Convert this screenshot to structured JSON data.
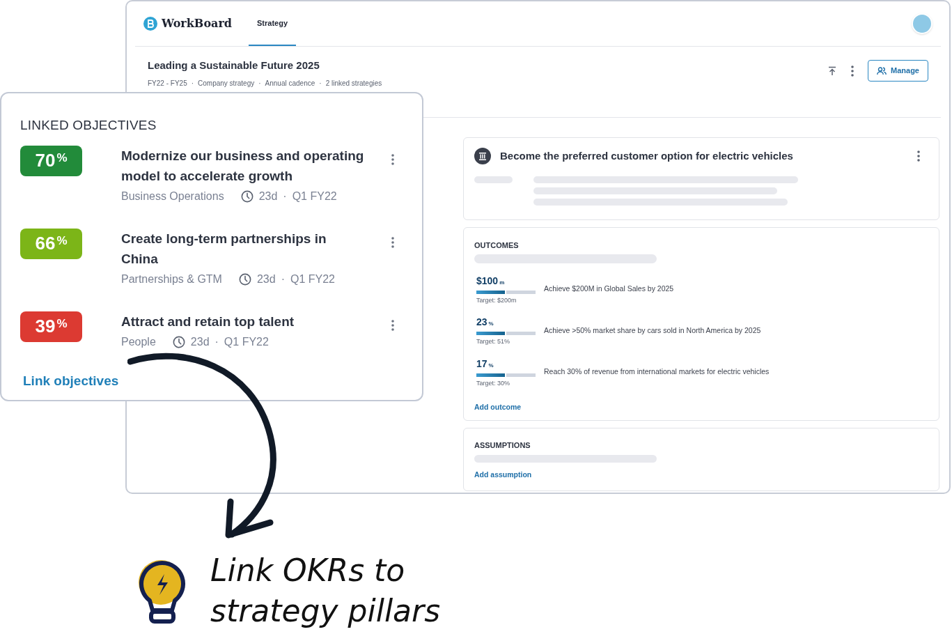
{
  "app": {
    "name": "WorkBoard",
    "tabs": [
      {
        "label": "Strategy",
        "selected": true
      }
    ]
  },
  "strategy": {
    "title": "Leading a Sustainable Future 2025",
    "separator": "·",
    "meta": [
      "FY22 - FY25",
      "Company strategy",
      "Annual cadence",
      "2 linked strategies"
    ],
    "manage_button": "Manage"
  },
  "pillar": {
    "title": "Become the preferred customer option for electric vehicles"
  },
  "outcomes": {
    "heading": "OUTCOMES",
    "items": [
      {
        "value": "$100",
        "unit": "m",
        "level": 0.5,
        "target": "Target: $200m",
        "text": "Achieve $200M in Global Sales by 2025"
      },
      {
        "value": "23",
        "unit": "%",
        "level": 0.5,
        "target": "Target: 51%",
        "text": "Achieve >50% market share by cars sold in North America by 2025"
      },
      {
        "value": "17",
        "unit": "%",
        "level": 0.5,
        "target": "Target: 30%",
        "text": "Reach 30% of revenue from international markets for electric vehicles"
      }
    ],
    "add_link": "Add outcome"
  },
  "assumptions": {
    "heading": "ASSUMPTIONS",
    "add_link": "Add assumption"
  },
  "linked_objectives": {
    "heading": "LINKED OBJECTIVES",
    "separator": "·",
    "items": [
      {
        "percent": "70",
        "unit": "%",
        "color": "#228b3a",
        "title": "Modernize our business and operating model to accelerate growth",
        "team": "Business Operations",
        "age": "23d",
        "period": "Q1 FY22"
      },
      {
        "percent": "66",
        "unit": "%",
        "color": "#7cb518",
        "title": "Create long-term partnerships in China",
        "team": "Partnerships & GTM",
        "age": "23d",
        "period": "Q1 FY22"
      },
      {
        "percent": "39",
        "unit": "%",
        "color": "#dc3a32",
        "title": "Attract and retain top talent",
        "team": "People",
        "age": "23d",
        "period": "Q1 FY22"
      }
    ],
    "link_action": "Link objectives"
  },
  "caption": {
    "lines": [
      "Link OKRs to",
      "strategy pillars"
    ]
  }
}
